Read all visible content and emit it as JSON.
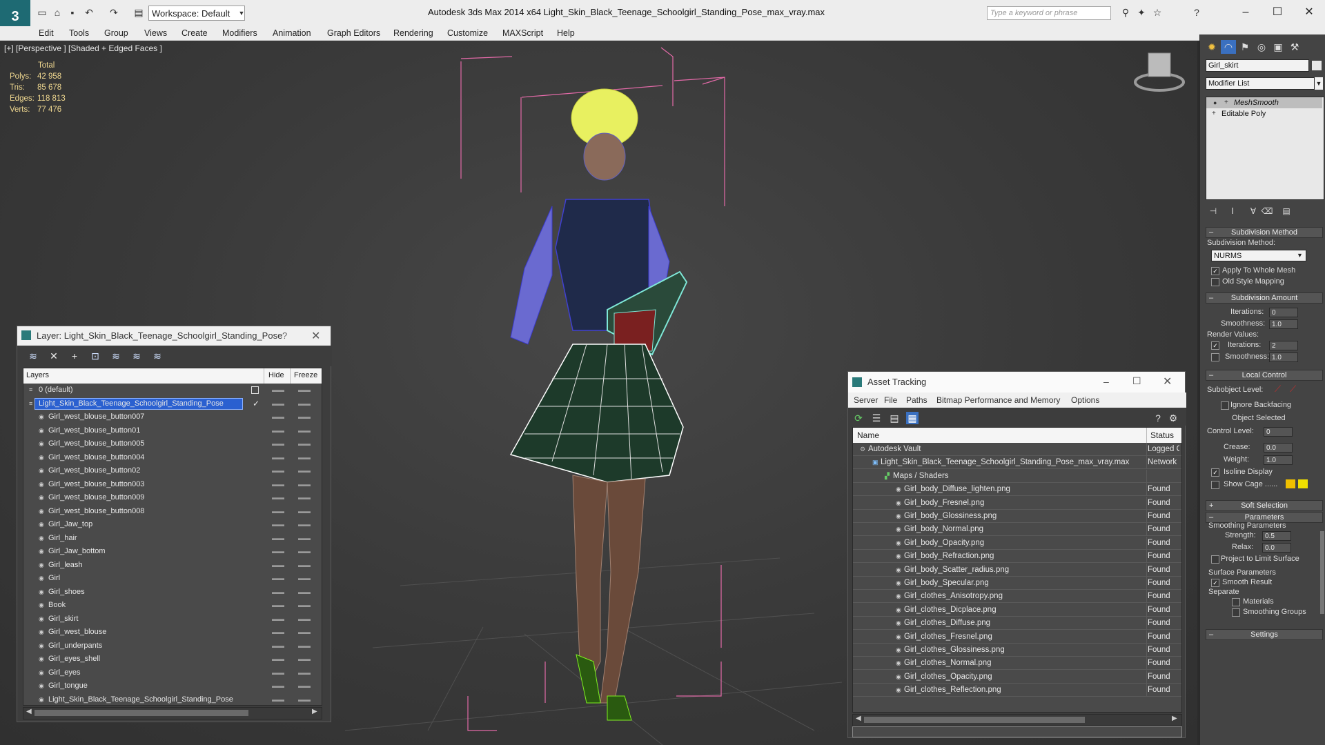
{
  "window": {
    "title": "Autodesk 3ds Max  2014 x64     Light_Skin_Black_Teenage_Schoolgirl_Standing_Pose_max_vray.max",
    "workspace": "Workspace: Default",
    "search_placeholder": "Type a keyword or phrase"
  },
  "menu": [
    "Edit",
    "Tools",
    "Group",
    "Views",
    "Create",
    "Modifiers",
    "Animation",
    "Graph Editors",
    "Rendering",
    "Customize",
    "MAXScript",
    "Help"
  ],
  "viewport": {
    "label": "[+] [Perspective ] [Shaded + Edged Faces ]",
    "stats": {
      "header": "Total",
      "rows": [
        {
          "k": "Polys:",
          "v": "42 958"
        },
        {
          "k": "Tris:",
          "v": "85 678"
        },
        {
          "k": "Edges:",
          "v": "118 813"
        },
        {
          "k": "Verts:",
          "v": "77 476"
        }
      ]
    },
    "colors": {
      "bbox": "#e36aa8",
      "hair": "#e8f060",
      "top": "#3a3acc",
      "skirt": "#1d3a2a"
    }
  },
  "layer_panel": {
    "title": "Layer: Light_Skin_Black_Teenage_Schoolgirl_Standing_Pose",
    "help": "?",
    "col_layers": "Layers",
    "col_hide": "Hide",
    "col_freeze": "Freeze",
    "rows": [
      {
        "name": "0 (default)",
        "level": 0
      },
      {
        "name": "Light_Skin_Black_Teenage_Schoolgirl_Standing_Pose",
        "level": 0,
        "selected": true
      },
      {
        "name": "Girl_west_blouse_button007",
        "level": 1
      },
      {
        "name": "Girl_west_blouse_button01",
        "level": 1
      },
      {
        "name": "Girl_west_blouse_button005",
        "level": 1
      },
      {
        "name": "Girl_west_blouse_button004",
        "level": 1
      },
      {
        "name": "Girl_west_blouse_button02",
        "level": 1
      },
      {
        "name": "Girl_west_blouse_button003",
        "level": 1
      },
      {
        "name": "Girl_west_blouse_button009",
        "level": 1
      },
      {
        "name": "Girl_west_blouse_button008",
        "level": 1
      },
      {
        "name": "Girl_Jaw_top",
        "level": 1
      },
      {
        "name": "Girl_hair",
        "level": 1
      },
      {
        "name": "Girl_Jaw_bottom",
        "level": 1
      },
      {
        "name": "Girl_leash",
        "level": 1
      },
      {
        "name": "Girl",
        "level": 1
      },
      {
        "name": "Girl_shoes",
        "level": 1
      },
      {
        "name": "Book",
        "level": 1
      },
      {
        "name": "Girl_skirt",
        "level": 1
      },
      {
        "name": "Girl_west_blouse",
        "level": 1
      },
      {
        "name": "Girl_underpants",
        "level": 1
      },
      {
        "name": "Girl_eyes_shell",
        "level": 1
      },
      {
        "name": "Girl_eyes",
        "level": 1
      },
      {
        "name": "Girl_tongue",
        "level": 1
      },
      {
        "name": "Light_Skin_Black_Teenage_Schoolgirl_Standing_Pose",
        "level": 1
      }
    ]
  },
  "asset_panel": {
    "title": "Asset Tracking",
    "menu": [
      "Server",
      "File",
      "Paths",
      "Bitmap Performance and Memory",
      "Options"
    ],
    "col_name": "Name",
    "col_status": "Status",
    "rows": [
      {
        "name": "Autodesk Vault",
        "status": "Logged O",
        "level": 0
      },
      {
        "name": "Light_Skin_Black_Teenage_Schoolgirl_Standing_Pose_max_vray.max",
        "status": "Network",
        "level": 1
      },
      {
        "name": "Maps / Shaders",
        "status": "",
        "level": 2
      },
      {
        "name": "Girl_body_Diffuse_lighten.png",
        "status": "Found",
        "level": 3
      },
      {
        "name": "Girl_body_Fresnel.png",
        "status": "Found",
        "level": 3
      },
      {
        "name": "Girl_body_Glossiness.png",
        "status": "Found",
        "level": 3
      },
      {
        "name": "Girl_body_Normal.png",
        "status": "Found",
        "level": 3
      },
      {
        "name": "Girl_body_Opacity.png",
        "status": "Found",
        "level": 3
      },
      {
        "name": "Girl_body_Refraction.png",
        "status": "Found",
        "level": 3
      },
      {
        "name": "Girl_body_Scatter_radius.png",
        "status": "Found",
        "level": 3
      },
      {
        "name": "Girl_body_Specular.png",
        "status": "Found",
        "level": 3
      },
      {
        "name": "Girl_clothes_Anisotropy.png",
        "status": "Found",
        "level": 3
      },
      {
        "name": "Girl_clothes_Dicplace.png",
        "status": "Found",
        "level": 3
      },
      {
        "name": "Girl_clothes_Diffuse.png",
        "status": "Found",
        "level": 3
      },
      {
        "name": "Girl_clothes_Fresnel.png",
        "status": "Found",
        "level": 3
      },
      {
        "name": "Girl_clothes_Glossiness.png",
        "status": "Found",
        "level": 3
      },
      {
        "name": "Girl_clothes_Normal.png",
        "status": "Found",
        "level": 3
      },
      {
        "name": "Girl_clothes_Opacity.png",
        "status": "Found",
        "level": 3
      },
      {
        "name": "Girl_clothes_Reflection.png",
        "status": "Found",
        "level": 3
      }
    ]
  },
  "command_panel": {
    "object_name": "Girl_skirt",
    "modifier_list": "Modifier List",
    "stack": [
      "MeshSmooth",
      "Editable Poly"
    ],
    "subdivision_method": {
      "title": "Subdivision Method",
      "label": "Subdivision Method:",
      "value": "NURMS",
      "apply_whole": "Apply To Whole Mesh",
      "old_style": "Old Style Mapping"
    },
    "subdivision_amount": {
      "title": "Subdivision Amount",
      "iterations_label": "Iterations:",
      "iterations": "0",
      "smoothness_label": "Smoothness:",
      "smoothness": "1.0",
      "render_values": "Render Values:",
      "r_iterations": "2",
      "r_smoothness": "1.0"
    },
    "local_control": {
      "title": "Local Control",
      "subobject": "Subobject Level:",
      "ignore_backfacing": "Ignore Backfacing",
      "object_selected": "Object Selected",
      "control_level_label": "Control Level:",
      "control_level": "0",
      "crease_label": "Crease:",
      "crease": "0.0",
      "weight_label": "Weight:",
      "weight": "1.0",
      "isoline": "Isoline Display",
      "show_cage": "Show Cage ......",
      "cage_color1": "#f0c000",
      "cage_color2": "#f0e000"
    },
    "soft_selection": "Soft Selection",
    "parameters": {
      "title": "Parameters",
      "smoothing_params": "Smoothing Parameters",
      "strength_label": "Strength:",
      "strength": "0.5",
      "relax_label": "Relax:",
      "relax": "0.0",
      "project": "Project to Limit Surface",
      "surface_params": "Surface Parameters",
      "smooth_result": "Smooth Result",
      "separate": "Separate",
      "materials": "Materials",
      "smoothing_groups": "Smoothing Groups"
    },
    "settings": "Settings"
  }
}
